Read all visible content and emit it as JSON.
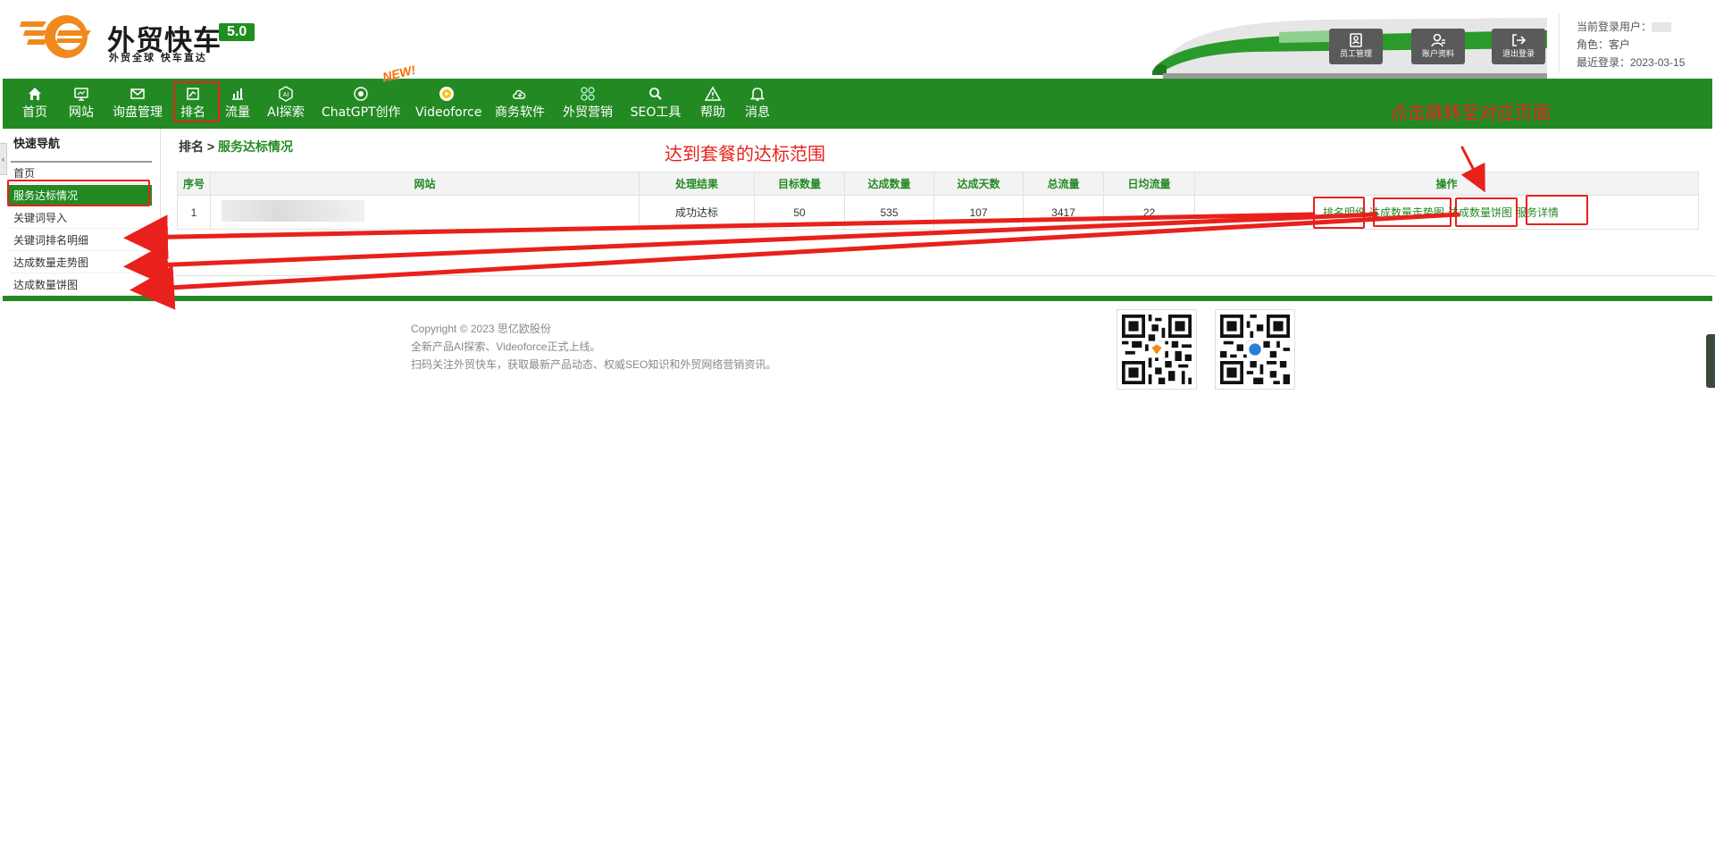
{
  "brand": {
    "title": "外贸快车",
    "version": "5.0",
    "slogan": "外贸全球 快车直达"
  },
  "header_buttons": [
    {
      "label": "员工管理",
      "icon": "staff-icon"
    },
    {
      "label": "账户资料",
      "icon": "account-icon"
    },
    {
      "label": "退出登录",
      "icon": "logout-icon"
    }
  ],
  "user": {
    "current_label": "当前登录用户：",
    "role_label": "角色：客户",
    "last_login": "最近登录：2023-03-15"
  },
  "nav": [
    {
      "label": "首页",
      "icon": "home-icon"
    },
    {
      "label": "网站",
      "icon": "monitor-icon"
    },
    {
      "label": "询盘管理",
      "icon": "mail-icon"
    },
    {
      "label": "排名",
      "icon": "ranking-icon"
    },
    {
      "label": "流量",
      "icon": "bar-chart-icon"
    },
    {
      "label": "AI探索",
      "icon": "ai-icon"
    },
    {
      "label": "ChatGPT创作",
      "icon": "chatgpt-icon"
    },
    {
      "label": "Videoforce",
      "icon": "video-icon"
    },
    {
      "label": "商务软件",
      "icon": "cloud-icon"
    },
    {
      "label": "外贸营销",
      "icon": "apps-icon"
    },
    {
      "label": "SEO工具",
      "icon": "search-icon"
    },
    {
      "label": "帮助",
      "icon": "warning-icon"
    },
    {
      "label": "消息",
      "icon": "bell-icon"
    }
  ],
  "new_badge": "NEW!",
  "sidebar": {
    "collapse": "‹",
    "title": "快速导航",
    "items": [
      "首页",
      "服务达标情况",
      "关键词导入",
      "关键词排名明细",
      "达成数量走势图",
      "达成数量饼图"
    ]
  },
  "breadcrumb": {
    "parent": "排名 > ",
    "current": "服务达标情况"
  },
  "table": {
    "headers": [
      "序号",
      "网站",
      "处理结果",
      "目标数量",
      "达成数量",
      "达成天数",
      "总流量",
      "日均流量",
      "操作"
    ],
    "rows": [
      {
        "index": "1",
        "result": "成功达标",
        "target": "50",
        "achieved": "535",
        "days": "107",
        "total": "3417",
        "daily": "22",
        "actions": [
          "排名明细",
          "达成数量走势图",
          "达成数量饼图",
          "服务详情"
        ]
      }
    ]
  },
  "annotations": {
    "range": "达到套餐的达标范围",
    "jump": "点击跳转至对应页面"
  },
  "footer": {
    "copyright": "Copyright © 2023 思亿欧股份",
    "line2": "全新产品AI探索、Videoforce正式上线。",
    "line3": "扫码关注外贸快车，获取最新产品动态、权威SEO知识和外贸网络营销资讯。"
  },
  "colors": {
    "brand_green": "#238a23",
    "annotation_red": "#e8211c",
    "logo_orange": "#f08a1c"
  }
}
